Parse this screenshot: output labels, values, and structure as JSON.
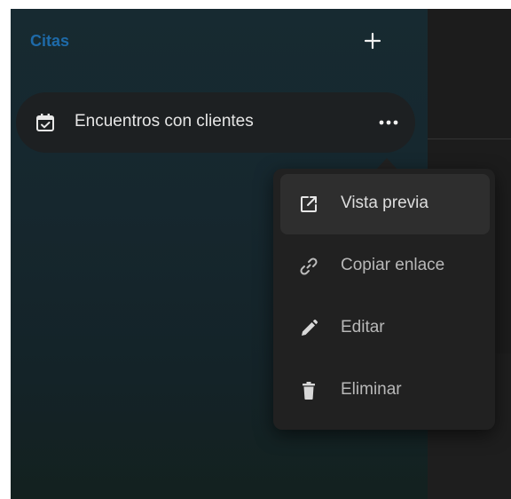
{
  "sidebar": {
    "section_title": "Citas",
    "add_label": "+",
    "items": [
      {
        "label": "Encuentros con clientes",
        "icon": "calendar-check-icon",
        "more_label": "•••"
      }
    ]
  },
  "menu": {
    "items": [
      {
        "label": "Vista previa",
        "icon": "open-external-icon",
        "active": true
      },
      {
        "label": "Copiar enlace",
        "icon": "link-icon",
        "active": false
      },
      {
        "label": "Editar",
        "icon": "pencil-icon",
        "active": false
      },
      {
        "label": "Eliminar",
        "icon": "trash-icon",
        "active": false
      }
    ]
  },
  "colors": {
    "accent": "#1e6aa8",
    "sidebar_bg": "#172a31",
    "menu_bg": "#212121",
    "text": "#e6e6e6"
  }
}
